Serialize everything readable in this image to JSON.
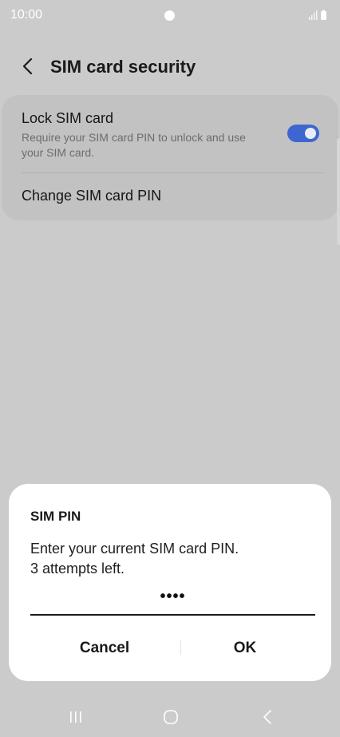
{
  "status_bar": {
    "time": "10:00"
  },
  "header": {
    "title": "SIM card security"
  },
  "settings": {
    "lock_sim": {
      "title": "Lock SIM card",
      "subtitle": "Require your SIM card PIN to unlock and use your SIM card.",
      "enabled": true
    },
    "change_pin": {
      "label": "Change SIM card PIN"
    }
  },
  "dialog": {
    "title": "SIM PIN",
    "message_line1": "Enter your current SIM card PIN.",
    "message_line2": "3 attempts left.",
    "pin_value": "••••",
    "cancel_label": "Cancel",
    "ok_label": "OK"
  },
  "colors": {
    "background": "#cbcbcb",
    "card": "#c2c2c2",
    "toggle_on": "#3d66d1",
    "dialog": "#ffffff"
  },
  "icons": {
    "back": "chevron-left-icon",
    "signal": "signal-icon",
    "battery": "battery-icon",
    "nav_recents": "recents-icon",
    "nav_home": "home-icon",
    "nav_back": "back-icon"
  }
}
